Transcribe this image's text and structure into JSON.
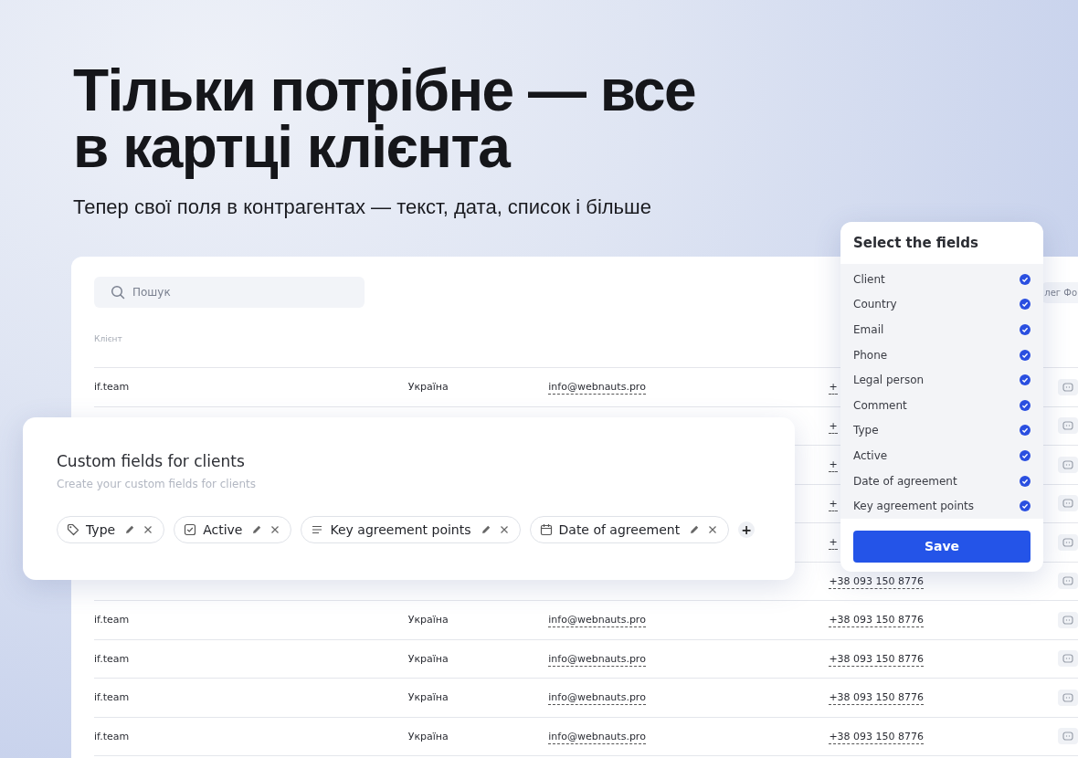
{
  "headline": {
    "lines": [
      "Тільки потрібне — все",
      "в картці клієнта"
    ],
    "subtitle": "Тепер свої поля в контрагентах — текст, дата, список і більше"
  },
  "table": {
    "search": {
      "placeholder": "Пошук"
    },
    "header_chip": "лег Фо",
    "columns": [
      "Клієнт"
    ],
    "rows": [
      {
        "kind": "row",
        "client": "if.team",
        "country": "Україна",
        "email": "info@webnauts.pro",
        "phone": "+"
      },
      {
        "kind": "covered",
        "phone": "+"
      },
      {
        "kind": "covered",
        "phone": "+"
      },
      {
        "kind": "covered",
        "phone": "+"
      },
      {
        "kind": "covered",
        "phone": "+"
      },
      {
        "kind": "covered",
        "phone": "+38 093 150 8776"
      },
      {
        "kind": "row",
        "client": "if.team",
        "country": "Україна",
        "email": "info@webnauts.pro",
        "phone": "+38 093 150 8776"
      },
      {
        "kind": "row",
        "client": "if.team",
        "country": "Україна",
        "email": "info@webnauts.pro",
        "phone": "+38 093 150 8776"
      },
      {
        "kind": "row",
        "client": "if.team",
        "country": "Україна",
        "email": "info@webnauts.pro",
        "phone": "+38 093 150 8776"
      },
      {
        "kind": "row",
        "client": "if.team",
        "country": "Україна",
        "email": "info@webnauts.pro",
        "phone": "+38 093 150 8776"
      }
    ]
  },
  "custom_fields": {
    "title": "Custom fields for clients",
    "subtitle": "Create your custom fields for clients",
    "chips": [
      {
        "kind": "tag",
        "label": "Type"
      },
      {
        "kind": "checkbox",
        "label": "Active"
      },
      {
        "kind": "text",
        "label": "Key agreement points"
      },
      {
        "kind": "date",
        "label": "Date of agreement"
      }
    ],
    "add": "+"
  },
  "field_picker": {
    "title": "Select the fields",
    "items": [
      {
        "label": "Client",
        "checked": true
      },
      {
        "label": "Country",
        "checked": true
      },
      {
        "label": "Email",
        "checked": true
      },
      {
        "label": "Phone",
        "checked": true
      },
      {
        "label": "Legal person",
        "checked": true
      },
      {
        "label": "Comment",
        "checked": true
      },
      {
        "label": "Type",
        "checked": true
      },
      {
        "label": "Active",
        "checked": true
      },
      {
        "label": "Date of agreement",
        "checked": true
      },
      {
        "label": "Key agreement points",
        "checked": true
      }
    ],
    "button": "Save"
  }
}
